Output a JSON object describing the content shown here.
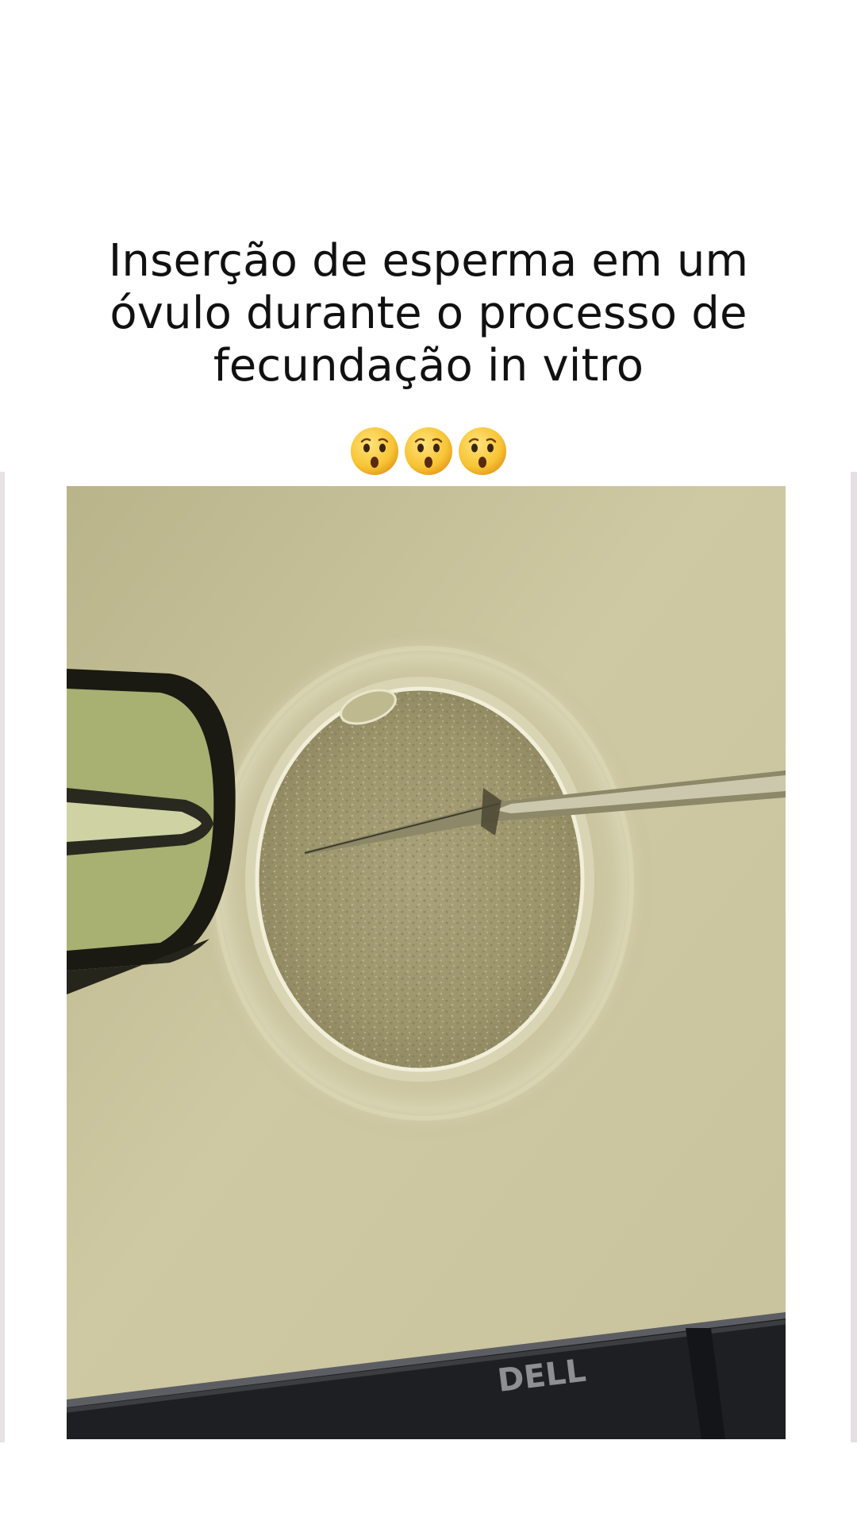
{
  "caption": {
    "line1": "Inserção de esperma em um",
    "line2": "óvulo durante o processo de",
    "line3": "fecundação in vitro"
  },
  "emojis": [
    "hushed-face",
    "hushed-face",
    "hushed-face"
  ],
  "video": {
    "monitor_brand": "DELL"
  },
  "colors": {
    "background": "#ffffff",
    "caption_text": "#111111",
    "microscope_background": "#c9c39a",
    "emoji_yellow": "#f7c434"
  }
}
